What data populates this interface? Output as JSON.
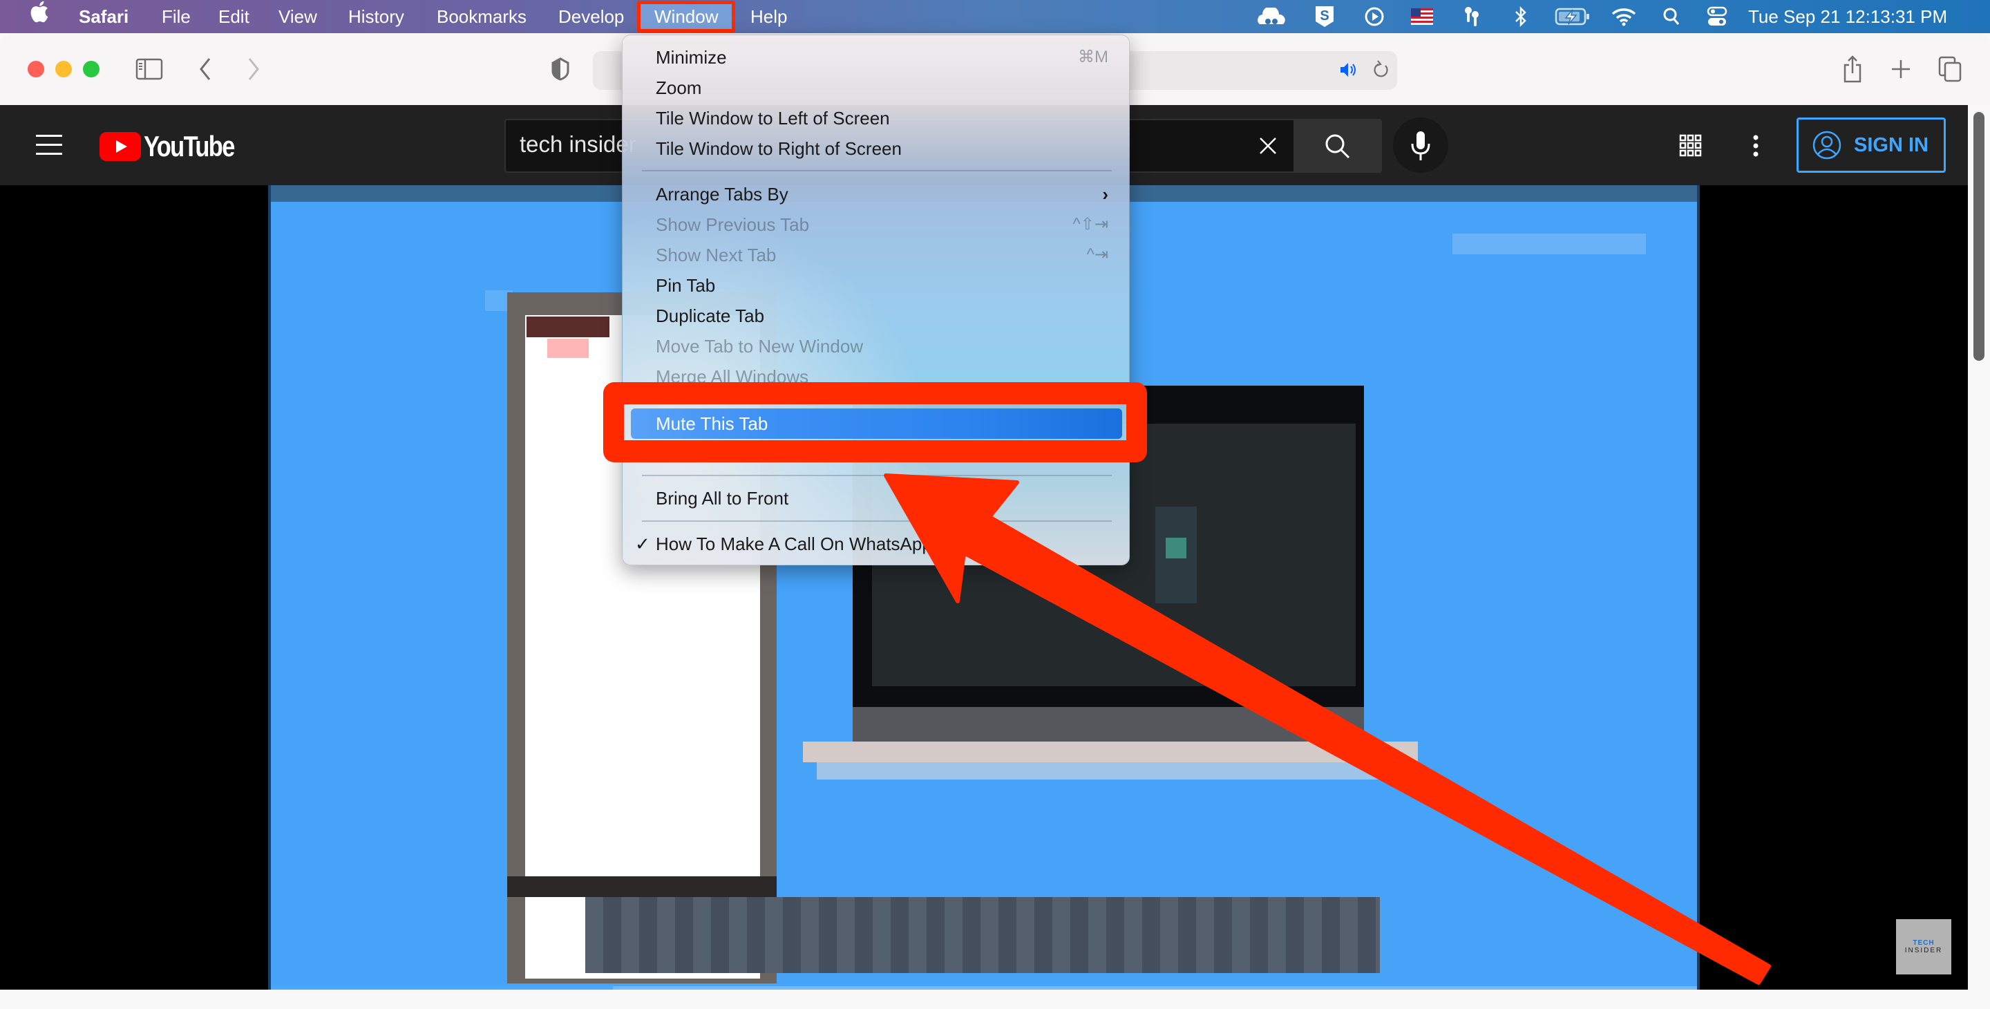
{
  "menubar": {
    "apple_icon": "apple-logo",
    "app_name": "Safari",
    "menus": [
      "File",
      "Edit",
      "View",
      "History",
      "Bookmarks",
      "Develop",
      "Window",
      "Help"
    ],
    "active_menu": "Window",
    "status_icons": [
      "creative-cloud-icon",
      "s-shield-icon",
      "play-circle-icon",
      "us-flag-icon",
      "airpods-icon",
      "bluetooth-icon",
      "battery-charging-icon",
      "wifi-icon",
      "spotlight-search-icon",
      "control-center-icon"
    ],
    "clock": "Tue Sep 21  12:13:31 PM"
  },
  "safari_toolbar": {
    "sidebar_icon": "sidebar-icon",
    "back_icon": "chevron-left-icon",
    "forward_icon": "chevron-right-icon",
    "privacy_icon": "shield-half-icon",
    "address_value": "",
    "audio_icon": "speaker-playing-icon",
    "reload_icon": "reload-icon",
    "share_icon": "share-icon",
    "new_tab_icon": "plus-icon",
    "tab_overview_icon": "tabs-overview-icon",
    "colors": {
      "audio_accent": "#0a60ff"
    }
  },
  "youtube": {
    "logo_text": "YouTube",
    "search_value": "tech insider",
    "clear_icon": "close-icon",
    "search_icon": "search-icon",
    "mic_icon": "microphone-icon",
    "apps_icon": "apps-grid-icon",
    "more_icon": "more-vertical-icon",
    "sign_in_label": "SIGN IN",
    "colors": {
      "brand_red": "#ff0000",
      "sign_in_blue": "#3ea6ff",
      "header_bg": "#212121"
    }
  },
  "video": {
    "watermark_line1": "TECH",
    "watermark_line2": "INSIDER",
    "progress_percent": 24
  },
  "window_menu": {
    "items": [
      {
        "label": "Minimize",
        "shortcut": "⌘M",
        "enabled": true
      },
      {
        "label": "Zoom",
        "shortcut": "",
        "enabled": true
      },
      {
        "label": "Tile Window to Left of Screen",
        "shortcut": "",
        "enabled": true
      },
      {
        "label": "Tile Window to Right of Screen",
        "shortcut": "",
        "enabled": true
      },
      {
        "label": "Arrange Tabs By",
        "shortcut": "",
        "enabled": true,
        "submenu": true
      },
      {
        "label": "Show Previous Tab",
        "shortcut": "^⇧⇥",
        "enabled": false
      },
      {
        "label": "Show Next Tab",
        "shortcut": "^⇥",
        "enabled": false
      },
      {
        "label": "Pin Tab",
        "shortcut": "",
        "enabled": true
      },
      {
        "label": "Duplicate Tab",
        "shortcut": "",
        "enabled": true
      },
      {
        "label": "Move Tab to New Window",
        "shortcut": "",
        "enabled": false
      },
      {
        "label": "Merge All Windows",
        "shortcut": "",
        "enabled": false
      },
      {
        "label": "Mute This Tab",
        "shortcut": "",
        "enabled": true,
        "highlighted": true
      },
      {
        "label": "Bring All to Front",
        "shortcut": "",
        "enabled": true
      },
      {
        "label": "How To Make A Call On WhatsApp",
        "shortcut": "",
        "enabled": true,
        "checked": true
      }
    ],
    "submenu_arrow": "›",
    "checkmark": "✓",
    "colors": {
      "highlight": "#2d83ee"
    }
  },
  "annotation": {
    "color": "#ff2a00",
    "target": "Mute This Tab"
  }
}
